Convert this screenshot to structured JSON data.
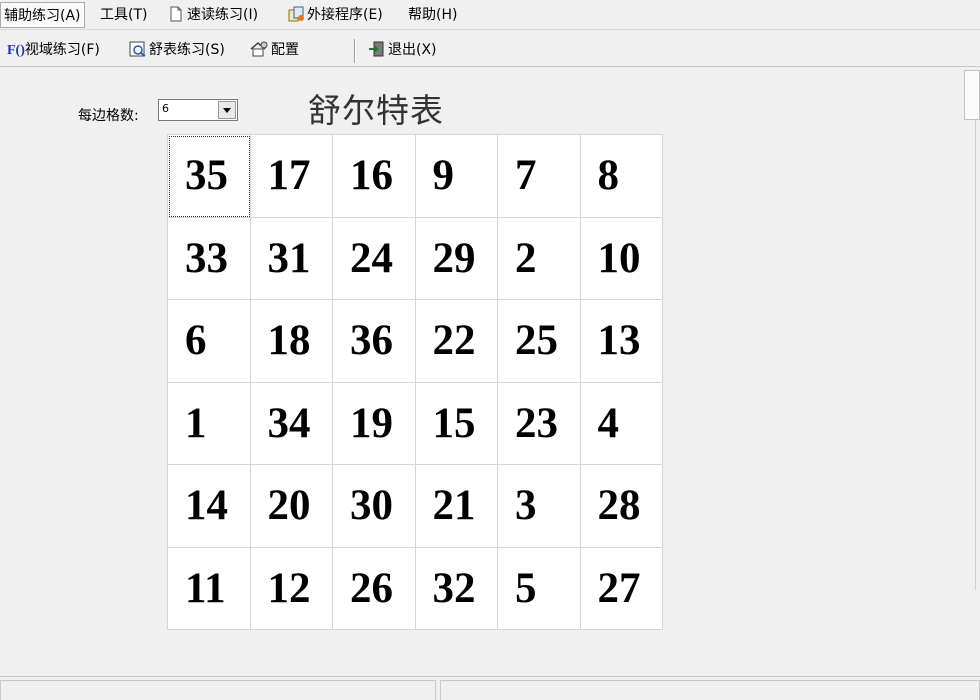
{
  "menu": {
    "items": [
      {
        "label": "辅助练习(A)"
      },
      {
        "label": "工具(T)"
      },
      {
        "label": "速读练习(I)"
      },
      {
        "label": "外接程序(E)"
      },
      {
        "label": "帮助(H)"
      }
    ]
  },
  "toolbar": {
    "visual_label": "视域练习(F)",
    "visual_icon_text": "F()",
    "schulte_label": "舒表练习(S)",
    "config_label": "配置",
    "exit_label": "退出(X)"
  },
  "settings": {
    "cells_per_side_label": "每边格数:",
    "cells_per_side_value": "6"
  },
  "title": "舒尔特表",
  "grid": {
    "size": 6,
    "numbers": [
      [
        "35",
        "17",
        "16",
        "9",
        "7",
        "8"
      ],
      [
        "33",
        "31",
        "24",
        "29",
        "2",
        "10"
      ],
      [
        "6",
        "18",
        "36",
        "22",
        "25",
        "13"
      ],
      [
        "1",
        "34",
        "19",
        "15",
        "23",
        "4"
      ],
      [
        "14",
        "20",
        "30",
        "21",
        "3",
        "28"
      ],
      [
        "11",
        "12",
        "26",
        "32",
        "5",
        "27"
      ]
    ]
  },
  "icons": {
    "doc": "document-icon",
    "plugin": "plugin-icon",
    "schulte": "magnifier-doc-icon",
    "config": "house-gear-icon",
    "exit": "exit-door-icon"
  }
}
